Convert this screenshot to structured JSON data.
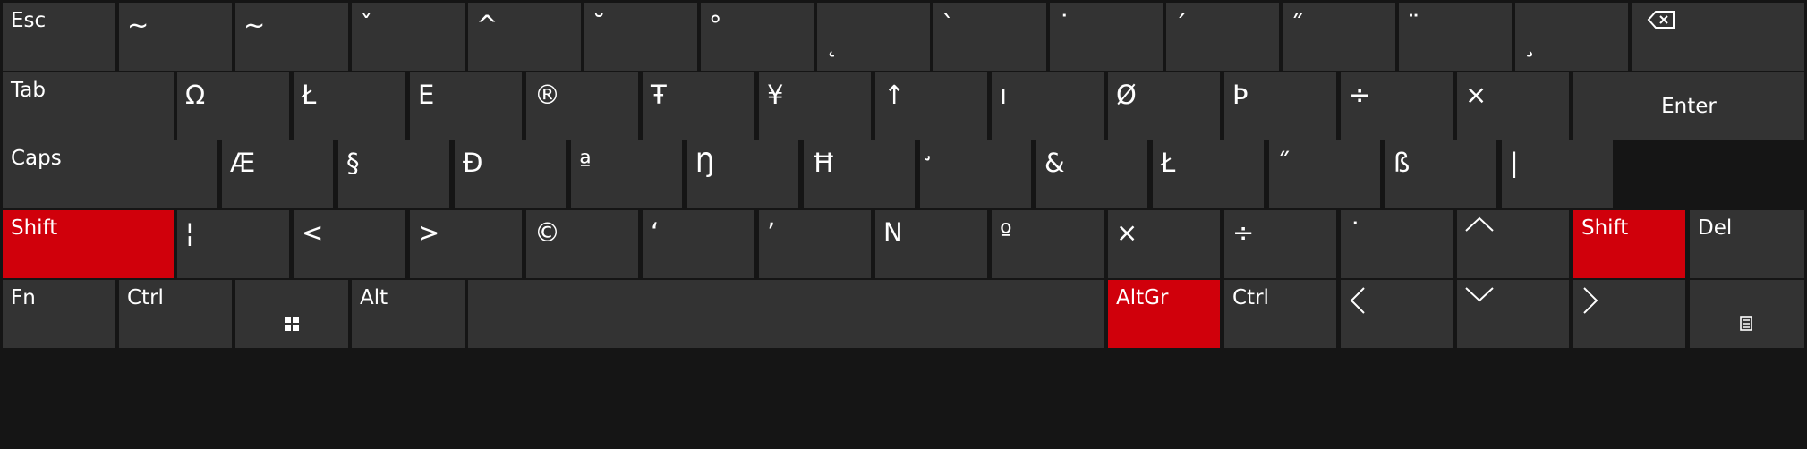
{
  "keyboard": {
    "colors": {
      "background": "#151515",
      "key": "#333333",
      "pressed": "#d0000b",
      "text": "#ffffff"
    },
    "rows": [
      [
        {
          "id": "esc",
          "label": "Esc"
        },
        {
          "id": "k-1",
          "label": "~",
          "sym": true
        },
        {
          "id": "k-2",
          "label": "~",
          "sym": true
        },
        {
          "id": "k-3",
          "label": "ˇ",
          "sym": true
        },
        {
          "id": "k-4",
          "label": "^",
          "sym": true
        },
        {
          "id": "k-5",
          "label": "˘",
          "sym": true
        },
        {
          "id": "k-6",
          "label": "°",
          "sym": true
        },
        {
          "id": "k-7",
          "label": "˛",
          "sym": true,
          "low": true
        },
        {
          "id": "k-8",
          "label": "`",
          "sym": true
        },
        {
          "id": "k-9",
          "label": "˙",
          "sym": true
        },
        {
          "id": "k-10",
          "label": "´",
          "sym": true
        },
        {
          "id": "k-11",
          "label": "˝",
          "sym": true
        },
        {
          "id": "k-12",
          "label": "¨",
          "sym": true
        },
        {
          "id": "k-13",
          "label": "¸",
          "sym": true,
          "low": true
        },
        {
          "id": "backspace",
          "label": "",
          "icon": "backspace-icon"
        }
      ],
      [
        {
          "id": "tab",
          "label": "Tab"
        },
        {
          "id": "q",
          "label": "Ω",
          "sym": true
        },
        {
          "id": "w",
          "label": "Ł",
          "sym": true
        },
        {
          "id": "e",
          "label": "E",
          "sym": true
        },
        {
          "id": "r",
          "label": "®",
          "sym": true
        },
        {
          "id": "t",
          "label": "Ŧ",
          "sym": true
        },
        {
          "id": "y",
          "label": "¥",
          "sym": true
        },
        {
          "id": "u",
          "label": "↑",
          "sym": true
        },
        {
          "id": "i",
          "label": "ı",
          "sym": true
        },
        {
          "id": "o",
          "label": "Ø",
          "sym": true
        },
        {
          "id": "p",
          "label": "Þ",
          "sym": true
        },
        {
          "id": "lbracket",
          "label": "÷",
          "sym": true
        },
        {
          "id": "rbracket",
          "label": "×",
          "sym": true
        },
        {
          "id": "enter",
          "label": "Enter",
          "center": true
        }
      ],
      [
        {
          "id": "caps",
          "label": "Caps"
        },
        {
          "id": "a",
          "label": "Æ",
          "sym": true
        },
        {
          "id": "s",
          "label": "§",
          "sym": true
        },
        {
          "id": "d",
          "label": "Đ",
          "sym": true
        },
        {
          "id": "f",
          "label": "ª",
          "sym": true
        },
        {
          "id": "g",
          "label": "Ŋ",
          "sym": true
        },
        {
          "id": "h",
          "label": "Ħ",
          "sym": true
        },
        {
          "id": "j",
          "label": "̛",
          "sym": true
        },
        {
          "id": "k",
          "label": "&",
          "sym": true
        },
        {
          "id": "l",
          "label": "Ł",
          "sym": true
        },
        {
          "id": "semicolon",
          "label": "˝",
          "sym": true
        },
        {
          "id": "quote",
          "label": "ß",
          "sym": true
        },
        {
          "id": "backslash",
          "label": "|",
          "sym": true
        }
      ],
      [
        {
          "id": "lshift",
          "label": "Shift",
          "pressed": true
        },
        {
          "id": "oem102",
          "label": "¦",
          "sym": true
        },
        {
          "id": "z",
          "label": "<",
          "sym": true
        },
        {
          "id": "x",
          "label": ">",
          "sym": true
        },
        {
          "id": "c",
          "label": "©",
          "sym": true
        },
        {
          "id": "v",
          "label": "‘",
          "sym": true
        },
        {
          "id": "b",
          "label": "’",
          "sym": true
        },
        {
          "id": "n",
          "label": "N",
          "sym": true
        },
        {
          "id": "m",
          "label": "º",
          "sym": true
        },
        {
          "id": "comma",
          "label": "×",
          "sym": true
        },
        {
          "id": "period",
          "label": "÷",
          "sym": true
        },
        {
          "id": "slash",
          "label": "˙",
          "sym": true
        },
        {
          "id": "up",
          "label": "",
          "icon": "arrow-up-icon"
        },
        {
          "id": "rshift",
          "label": "Shift",
          "pressed": true
        },
        {
          "id": "del",
          "label": "Del"
        }
      ],
      [
        {
          "id": "fn",
          "label": "Fn"
        },
        {
          "id": "lctrl",
          "label": "Ctrl"
        },
        {
          "id": "win",
          "label": "",
          "icon": "windows-icon"
        },
        {
          "id": "alt",
          "label": "Alt"
        },
        {
          "id": "space",
          "label": ""
        },
        {
          "id": "altgr",
          "label": "AltGr",
          "pressed": true
        },
        {
          "id": "rctrl",
          "label": "Ctrl"
        },
        {
          "id": "left",
          "label": "",
          "icon": "arrow-left-icon"
        },
        {
          "id": "down",
          "label": "",
          "icon": "arrow-down-icon"
        },
        {
          "id": "right",
          "label": "",
          "icon": "arrow-right-icon"
        },
        {
          "id": "menu",
          "label": "",
          "icon": "menu-icon"
        }
      ]
    ]
  }
}
